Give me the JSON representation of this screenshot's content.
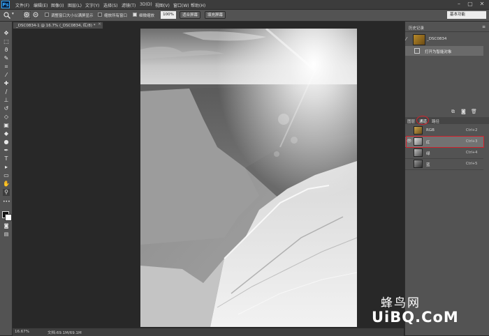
{
  "app": {
    "logo": "Ps"
  },
  "menu": [
    "文件(F)",
    "编辑(E)",
    "图像(I)",
    "图层(L)",
    "文字(Y)",
    "选择(S)",
    "滤镜(T)",
    "3D(D)",
    "视图(V)",
    "窗口(W)",
    "帮助(H)"
  ],
  "window_controls": [
    "–",
    "▢",
    "✕"
  ],
  "options_bar": {
    "resize_windows": "调整窗口大小以满屏显示",
    "zoom_all": "缩放所有窗口",
    "scrubby_zoom": "细微缩放",
    "zoom_value": "100%",
    "fit_screen": "适合屏幕",
    "fill_screen": "填充屏幕",
    "workspace": "基本功能"
  },
  "document_tab": {
    "title": "_DSC0834-1 @ 16.7% (_DSC0834, 红/8) *",
    "close": "×"
  },
  "status": {
    "zoom": "16.67%",
    "doc": "文档:69.1M/69.1M"
  },
  "history_panel": {
    "title": "历史记录",
    "snapshot": "_DSC0834",
    "step": "打开为智能对象"
  },
  "channels_panel": {
    "tabs": [
      "图层",
      "通道",
      "路径"
    ],
    "active_tab": "通道",
    "channels": [
      {
        "name": "RGB",
        "shortcut": "Ctrl+2",
        "visible": false
      },
      {
        "name": "红",
        "shortcut": "Ctrl+3",
        "visible": true
      },
      {
        "name": "绿",
        "shortcut": "Ctrl+4",
        "visible": false
      },
      {
        "name": "蓝",
        "shortcut": "Ctrl+5",
        "visible": false
      }
    ],
    "highlight_color": "#d0202a"
  },
  "watermark": {
    "cn": "蜂鸟网",
    "en": "UiBQ.CoM"
  },
  "colors": {
    "panel": "#535353",
    "canvas_bg": "#282828",
    "accent": "#d0202a"
  }
}
